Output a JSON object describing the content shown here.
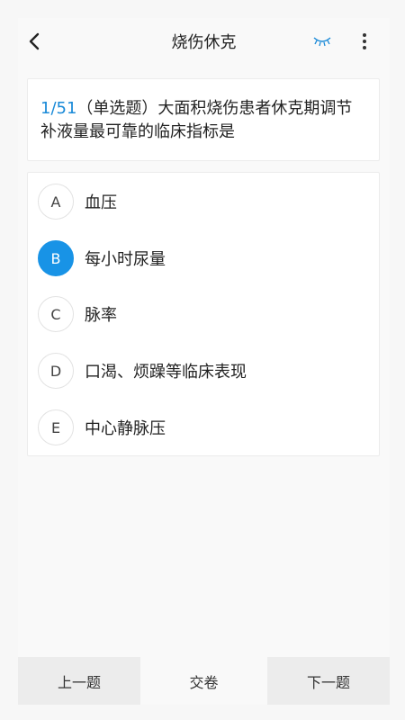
{
  "header": {
    "title": "烧伤休克",
    "back_icon": "chevron-left-icon",
    "eye_icon": "closed-eye-icon",
    "more_icon": "vertical-dots-icon",
    "accent_color": "#1a8ad8"
  },
  "question": {
    "index": "1/51",
    "type_label": "（单选题）",
    "text": "大面积烧伤患者休克期调节补液量最可靠的临床指标是"
  },
  "options": [
    {
      "letter": "A",
      "text": "血压",
      "selected": false
    },
    {
      "letter": "B",
      "text": "每小时尿量",
      "selected": true
    },
    {
      "letter": "C",
      "text": "脉率",
      "selected": false
    },
    {
      "letter": "D",
      "text": "口渴、烦躁等临床表现",
      "selected": false
    },
    {
      "letter": "E",
      "text": "中心静脉压",
      "selected": false
    }
  ],
  "footer": {
    "prev_label": "上一题",
    "submit_label": "交卷",
    "next_label": "下一题"
  }
}
